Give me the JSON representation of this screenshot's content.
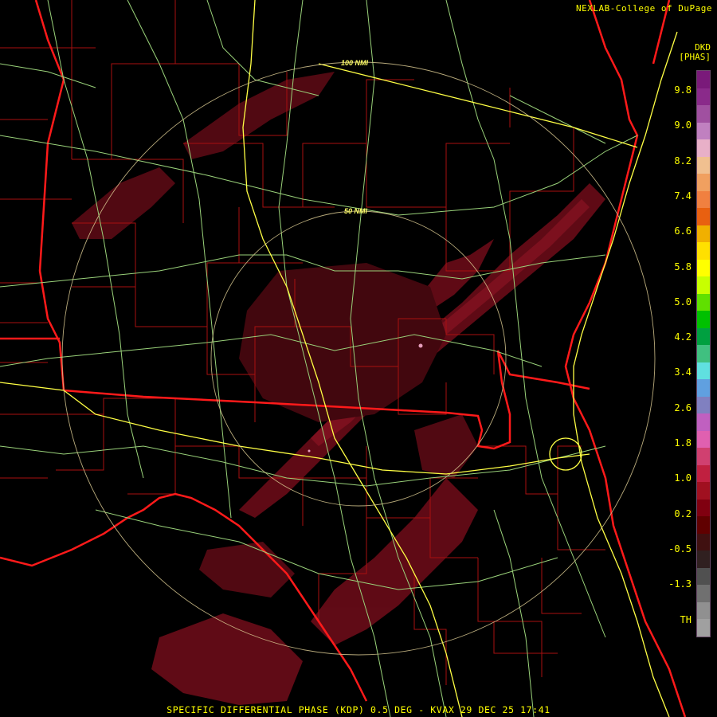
{
  "header": {
    "credit": "NEXLAB-College of DuPage",
    "product_code": "DKD",
    "product_units": "[PHAS]"
  },
  "range_rings": [
    {
      "label": "100 NMI"
    },
    {
      "label": "50 NMI"
    }
  ],
  "legend": {
    "ticks": [
      "9.8",
      "9.0",
      "8.2",
      "7.4",
      "6.6",
      "5.8",
      "5.0",
      "4.2",
      "3.4",
      "2.6",
      "1.8",
      "1.0",
      "0.2",
      "-0.5",
      "-1.3",
      "TH"
    ],
    "colors": [
      "#7a1a7a",
      "#8a2a8a",
      "#a050a0",
      "#c080c0",
      "#e8b0c8",
      "#f0c090",
      "#f0a060",
      "#f08040",
      "#e86010",
      "#f0b000",
      "#ffe000",
      "#ffff00",
      "#c8ff00",
      "#60e000",
      "#00c000",
      "#00a040",
      "#40c080",
      "#60e0e0",
      "#60a0e0",
      "#8080c0",
      "#c060c0",
      "#e060b0",
      "#d04070",
      "#c02040",
      "#a01020",
      "#800010",
      "#600000",
      "#401010",
      "#302020",
      "#505050",
      "#707070",
      "#909090",
      "#a0a0a0"
    ]
  },
  "caption": "SPECIFIC DIFFERENTIAL PHASE (KDP) 0.5 DEG - KVAX 29 DEC 25 17:41",
  "map_colors": {
    "background": "#000000",
    "state_borders": "#ff1a1a",
    "county_lines": "#b01010",
    "highways": "#ffff44",
    "roads": "#9ad27a",
    "range_rings": "#d8c890",
    "echo_dark": "#5a0a14",
    "echo_mid": "#7a1020",
    "echo_light": "#9a1828"
  }
}
